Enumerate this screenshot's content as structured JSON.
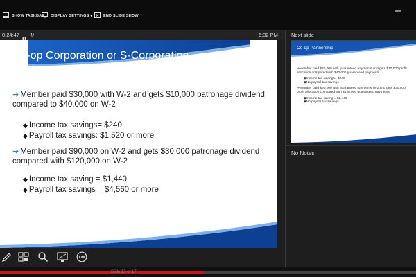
{
  "topbar": {
    "show_taskbar": "SHOW TASKBAR",
    "display_settings": "DISPLAY SETTINGS ▾",
    "end_slide_show": "END SLIDE SHOW"
  },
  "timer": {
    "elapsed": "0:24:47",
    "clock": "6:32 PM"
  },
  "current_slide": {
    "title": "Co-op Corporation or S-Corporation",
    "bullets": [
      {
        "text": "Member paid $30,000 with W-2 and gets $10,000 patronage dividend compared to $40,000 on W-2",
        "sub": [
          "Income tax savings= $240",
          "Payroll tax savings: $1,520 or more"
        ]
      },
      {
        "text": "Member paid $90,000 on W-2 and gets $30,000 patronage dividend compared with $120,000 on W-2",
        "sub": [
          "Income tax saving = $1,440",
          "Payroll tax savings = $4,560 or more"
        ]
      }
    ]
  },
  "next_slide": {
    "label": "Next slide",
    "title": "Co-op Partnership",
    "bullets": [
      {
        "text": "Member paid $30,000 with guaranteed payments and gets $10,000 profit allocation compared with $40,000 guaranteed payments",
        "sub": [
          "Income tax savings= $240",
          "No payroll tax savings"
        ]
      },
      {
        "text": "Member paid $90,000 with guaranteed payments W-2 and gets $30,000 profit allocation compared with $120,000 guaranteed payments",
        "sub": [
          "Income tax saving = $1,440",
          "No payroll tax savings"
        ]
      }
    ]
  },
  "notes": {
    "text": "No Notes."
  },
  "bottom": {
    "slide_counter": "Slide 15 of 17",
    "progress": 0.49
  },
  "colors": {
    "accent_blue": "#1f5fb5",
    "progress_red": "#c4161c"
  }
}
